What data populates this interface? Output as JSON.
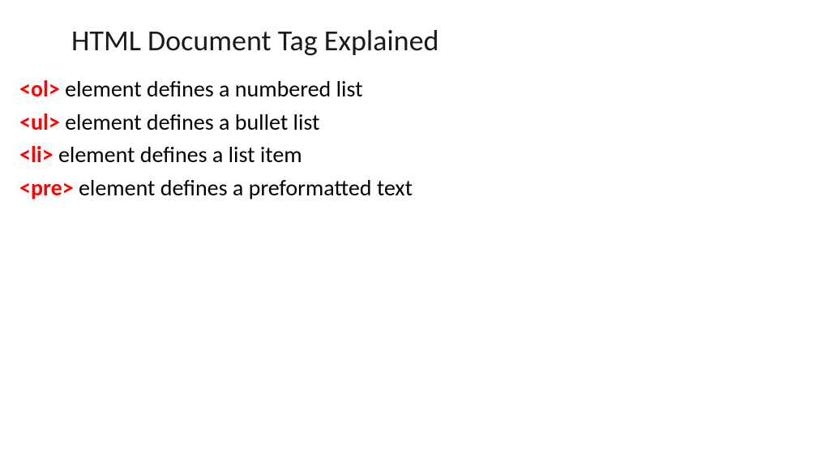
{
  "title": "HTML Document Tag Explained",
  "items": [
    {
      "tag": "<ol>",
      "desc": " element defines a numbered list"
    },
    {
      "tag": "<ul>",
      "desc": " element defines a bullet list"
    },
    {
      "tag": "<li>",
      "desc": " element defines a list item"
    },
    {
      "tag": "<pre>",
      "desc": " element defines a preformatted text"
    }
  ]
}
